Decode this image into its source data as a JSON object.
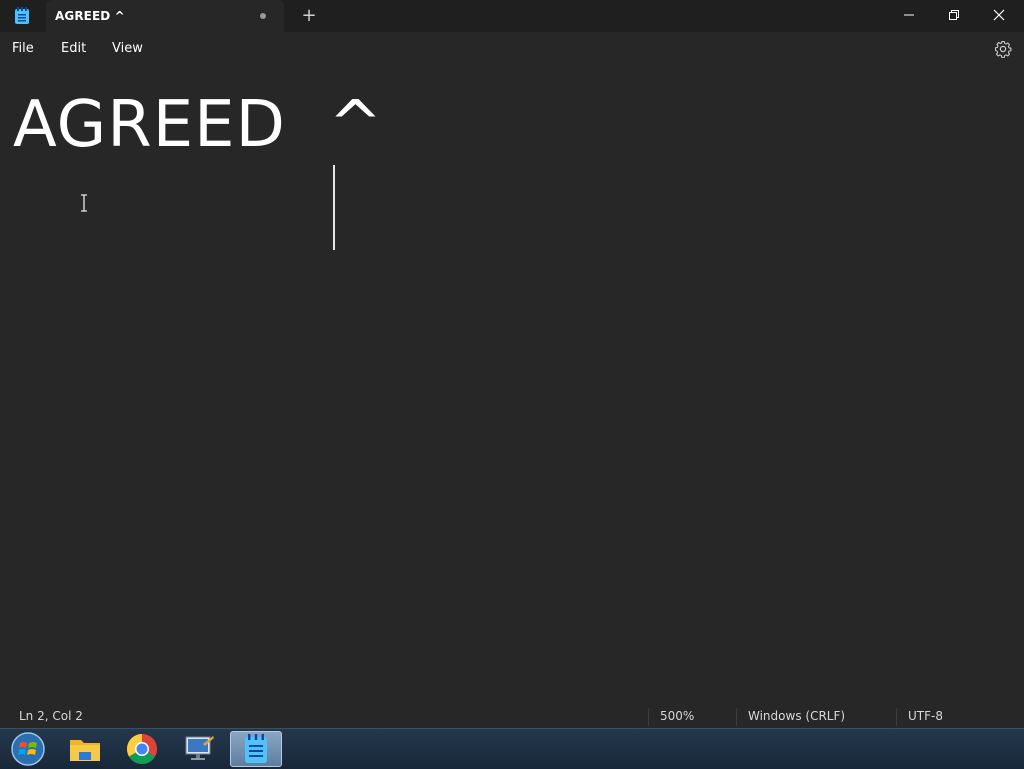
{
  "window": {
    "tab_title": "AGREED ^",
    "new_tab_icon": "plus-icon",
    "controls": [
      "minimize-icon",
      "maximize-icon",
      "close-icon"
    ]
  },
  "menu": {
    "file": "File",
    "edit": "Edit",
    "view": "View",
    "settings_icon": "gear-icon"
  },
  "editor": {
    "line1": "AGREED  ^",
    "line2": ""
  },
  "status": {
    "position": "Ln 2, Col 2",
    "zoom": "500%",
    "line_ending": "Windows (CRLF)",
    "encoding": "UTF-8"
  },
  "taskbar": {
    "items": [
      "start-orb-icon",
      "file-explorer-icon",
      "chrome-icon",
      "remote-desktop-icon",
      "notepad-icon"
    ],
    "active": "notepad-icon"
  },
  "colors": {
    "background": "#272727",
    "titlebar": "#1f1f1f",
    "text": "#ffffff",
    "taskbar": "#1c2b3a"
  }
}
